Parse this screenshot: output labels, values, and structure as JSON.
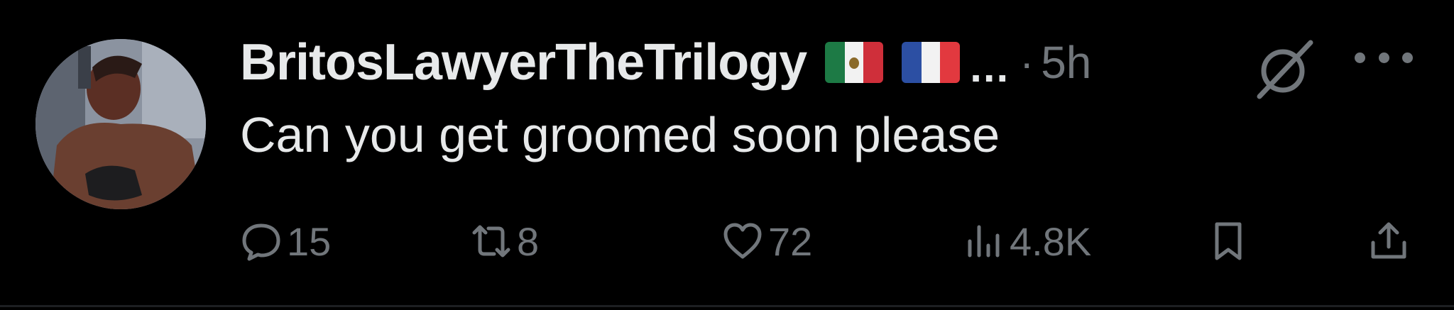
{
  "post": {
    "author": {
      "display_name": "BritosLawyerTheTrilogy",
      "flags": [
        "mexico-flag",
        "france-flag"
      ],
      "truncation": "...",
      "avatar": "avatar-photo"
    },
    "separator": "·",
    "timestamp": "5h",
    "text": "Can you get groomed soon please",
    "header_icons": [
      "grok-icon",
      "more-icon"
    ],
    "actions": {
      "replies": "15",
      "reposts": "8",
      "likes": "72",
      "views": "4.8K"
    }
  },
  "colors": {
    "background": "#000000",
    "primary_text": "#e7e9ea",
    "secondary_text": "#71767b",
    "divider": "#1d1f22"
  }
}
